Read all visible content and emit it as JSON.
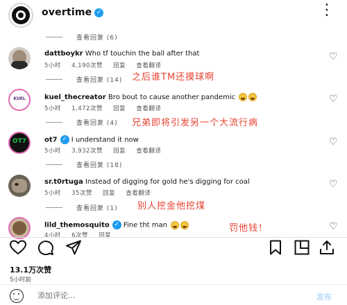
{
  "header": {
    "username": "overtime",
    "more_icon": "⋮"
  },
  "comments": [
    {
      "username": "dattboykr",
      "text": "Who tf touchin the ball after that",
      "time": "5小时",
      "likes": "4,190次赞",
      "reply": "回复",
      "translate": "查看翻译",
      "view_replies": "查看回复 (14)",
      "annotation": "之后谁TM还摸球啊"
    },
    {
      "username": "kuel_thecreator",
      "text": "Bro bout to cause another pandemic",
      "time": "5小时",
      "likes": "1,472次赞",
      "reply": "回复",
      "translate": "查看翻译",
      "view_replies": "查看回复 (4)",
      "annotation": "兄弟即将引发另一个大流行病"
    },
    {
      "username": "ot7",
      "text": "I understand it now",
      "time": "5小时",
      "likes": "3,932次赞",
      "reply": "回复",
      "translate": "查看翻译",
      "view_replies": "查看回复 (18)",
      "annotation": ""
    },
    {
      "username": "sr.t0rtuga",
      "text": "Instead of digging for gold he's digging for coal",
      "time": "5小时",
      "likes": "35次赞",
      "reply": "回复",
      "translate": "查看翻译",
      "view_replies": "查看回复 (1)",
      "annotation": "别人挖金他挖煤"
    },
    {
      "username": "lild_themosquito",
      "text": "Fine tht man",
      "time": "4小时",
      "likes": "6次赞",
      "reply": "回复",
      "translate": "",
      "view_replies": "",
      "annotation": "罚他钱！"
    }
  ],
  "top_view_replies": "查看回复 (6)",
  "ot7_avatar_text": "OT7",
  "kuel_avatar_text": "KUEL",
  "post": {
    "likes": "13.1万次赞",
    "time": "5小时前",
    "add_comment_placeholder": "添加评论...",
    "post_label": "发布"
  },
  "colors": {
    "accent": "#1d9bf0",
    "annotation": "#e8412f",
    "ot7_green": "#19c24a"
  }
}
